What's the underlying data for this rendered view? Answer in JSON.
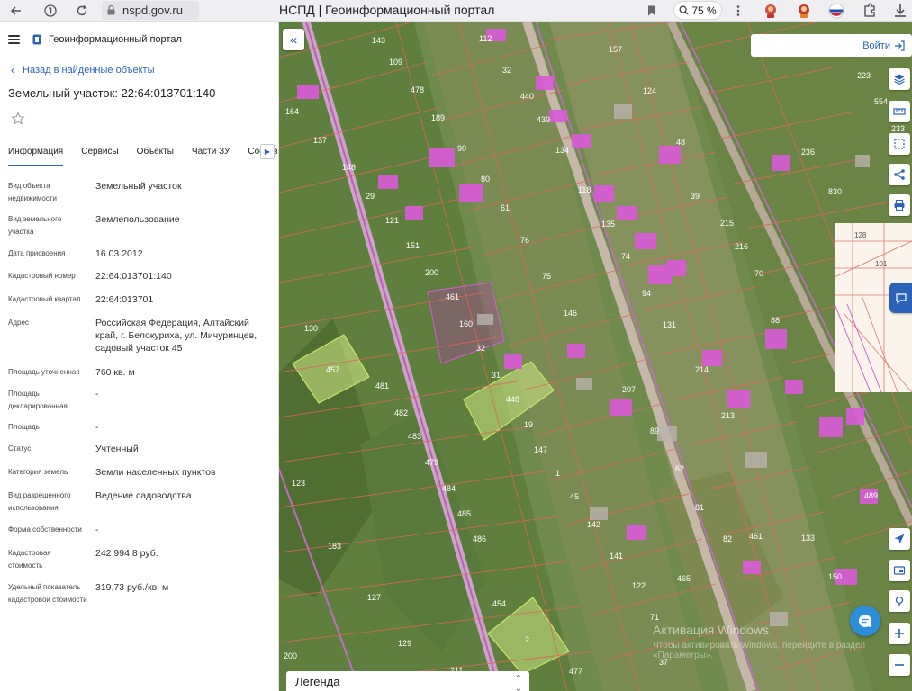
{
  "browser": {
    "url": "nspd.gov.ru",
    "tab_title": "НСПД | Геоинформационный портал",
    "zoom": "75 %",
    "icons": [
      "back-arrow-icon",
      "yandex-icon",
      "reload-icon",
      "lock-icon",
      "bookmark-icon",
      "search-zoom-icon",
      "more-icon",
      "extension-icon",
      "flag-ru-icon",
      "puzzle-icon",
      "download-icon"
    ]
  },
  "sidebar": {
    "portal_name": "Геоинформационный портал",
    "back_label": "Назад в найденные объекты",
    "title": "Земельный участок: 22:64:013701:140",
    "tabs": [
      {
        "label": "Информация",
        "active": true
      },
      {
        "label": "Сервисы"
      },
      {
        "label": "Объекты"
      },
      {
        "label": "Части ЗУ"
      },
      {
        "label": "Состав"
      }
    ],
    "properties": [
      {
        "label": "Вид объекта недвижимости",
        "value": "Земельный участок"
      },
      {
        "label": "Вид земельного участка",
        "value": "Землепользование"
      },
      {
        "label": "Дата присвоения",
        "value": "16.03.2012"
      },
      {
        "label": "Кадастровый номер",
        "value": "22:64:013701:140"
      },
      {
        "label": "Кадастровый квартал",
        "value": "22:64:013701"
      },
      {
        "label": "Адрес",
        "value": "Российская Федерация, Алтайский край, г. Белокуриха, ул. Мичуринцев, садовый участок 45"
      },
      {
        "label": "Площадь уточненная",
        "value": "760 кв. м"
      },
      {
        "label": "Площадь декларированная",
        "value": "-"
      },
      {
        "label": "Площадь",
        "value": "-"
      },
      {
        "label": "Статус",
        "value": "Учтенный"
      },
      {
        "label": "Категория земель",
        "value": "Земли населенных пунктов"
      },
      {
        "label": "Вид разрешенного использования",
        "value": "Ведение садоводства"
      },
      {
        "label": "Форма собственности",
        "value": "-"
      },
      {
        "label": "Кадастровая стоимость",
        "value": "242 994,8 руб."
      },
      {
        "label": "Удельный показатель кадастровой стоимости",
        "value": "319,73 руб./кв. м"
      }
    ]
  },
  "map": {
    "login_label": "Войти",
    "legend_label": "Легенда",
    "watermark_title": "Активация Windows",
    "watermark_text": "Чтобы активировать Windows, перейдите в раздел «Параметры».",
    "colors": {
      "satellite": "#6d8a4c",
      "parcel_line": "#e0665a",
      "road": "#c98ed0",
      "building": "#d95bd6",
      "selected_fill": "#d6ef86",
      "accent": "#2a63b8"
    },
    "right_tools": [
      "layers-icon",
      "ruler-icon",
      "measure-area-icon",
      "share-icon",
      "print-icon"
    ],
    "bottom_tools": [
      "locate-icon",
      "screen-icon",
      "pin-icon",
      "zoom-in-icon",
      "zoom-out-icon"
    ],
    "parcel_numbers": [
      {
        "n": "143"
      },
      {
        "n": "112"
      },
      {
        "n": "109"
      },
      {
        "n": "157"
      },
      {
        "n": "478"
      },
      {
        "n": "32"
      },
      {
        "n": "440"
      },
      {
        "n": "124"
      },
      {
        "n": "164"
      },
      {
        "n": "189"
      },
      {
        "n": "439"
      },
      {
        "n": "137"
      },
      {
        "n": "90"
      },
      {
        "n": "134"
      },
      {
        "n": "148"
      },
      {
        "n": "80"
      },
      {
        "n": "29"
      },
      {
        "n": "121"
      },
      {
        "n": "61"
      },
      {
        "n": "118"
      },
      {
        "n": "151"
      },
      {
        "n": "76"
      },
      {
        "n": "135"
      },
      {
        "n": "200"
      },
      {
        "n": "75"
      },
      {
        "n": "461"
      },
      {
        "n": "146"
      },
      {
        "n": "130"
      },
      {
        "n": "160"
      },
      {
        "n": "32"
      },
      {
        "n": "457"
      },
      {
        "n": "31"
      },
      {
        "n": "481"
      },
      {
        "n": "448"
      },
      {
        "n": "482"
      },
      {
        "n": "19"
      },
      {
        "n": "483"
      },
      {
        "n": "147"
      },
      {
        "n": "479"
      },
      {
        "n": "484"
      },
      {
        "n": "1"
      },
      {
        "n": "485"
      },
      {
        "n": "45"
      },
      {
        "n": "486"
      },
      {
        "n": "142"
      },
      {
        "n": "141"
      },
      {
        "n": "454"
      },
      {
        "n": "2"
      },
      {
        "n": "477"
      },
      {
        "n": "122"
      },
      {
        "n": "71"
      },
      {
        "n": "37"
      },
      {
        "n": "48"
      },
      {
        "n": "39"
      },
      {
        "n": "215"
      },
      {
        "n": "216"
      },
      {
        "n": "70"
      },
      {
        "n": "74"
      },
      {
        "n": "94"
      },
      {
        "n": "131"
      },
      {
        "n": "88"
      },
      {
        "n": "214"
      },
      {
        "n": "207"
      },
      {
        "n": "213"
      },
      {
        "n": "89"
      },
      {
        "n": "62"
      },
      {
        "n": "81"
      },
      {
        "n": "82"
      },
      {
        "n": "465"
      },
      {
        "n": "461"
      },
      {
        "n": "133"
      },
      {
        "n": "150"
      },
      {
        "n": "123"
      },
      {
        "n": "183"
      },
      {
        "n": "127"
      },
      {
        "n": "129"
      },
      {
        "n": "200"
      },
      {
        "n": "211"
      },
      {
        "n": "223"
      },
      {
        "n": "554"
      },
      {
        "n": "233"
      },
      {
        "n": "236"
      },
      {
        "n": "830"
      },
      {
        "n": "128"
      },
      {
        "n": "101"
      },
      {
        "n": "489"
      }
    ]
  }
}
